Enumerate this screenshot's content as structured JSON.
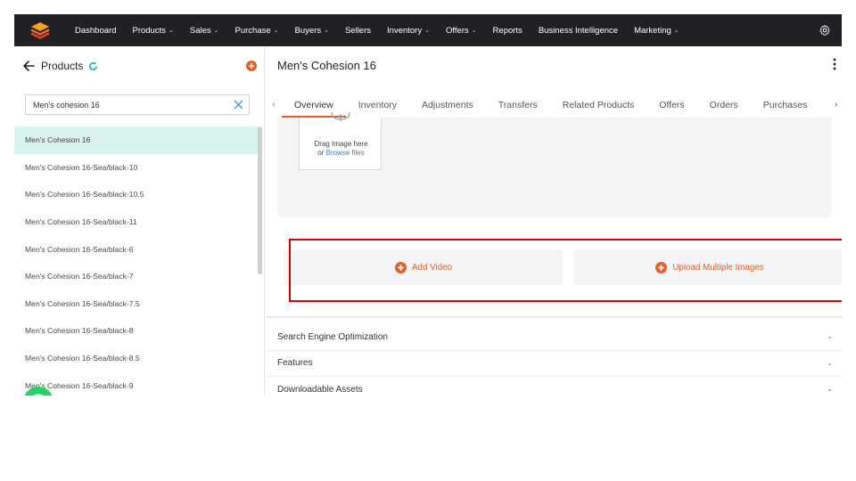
{
  "topnav": {
    "items": [
      {
        "label": "Dashboard",
        "has_dropdown": false
      },
      {
        "label": "Products",
        "has_dropdown": true
      },
      {
        "label": "Sales",
        "has_dropdown": true
      },
      {
        "label": "Purchase",
        "has_dropdown": true
      },
      {
        "label": "Buyers",
        "has_dropdown": true
      },
      {
        "label": "Sellers",
        "has_dropdown": false
      },
      {
        "label": "Inventory",
        "has_dropdown": true
      },
      {
        "label": "Offers",
        "has_dropdown": true
      },
      {
        "label": "Reports",
        "has_dropdown": false
      },
      {
        "label": "Business Intelligence",
        "has_dropdown": false
      },
      {
        "label": "Marketing",
        "has_dropdown": true
      }
    ],
    "chevron": "⌄"
  },
  "sidebar": {
    "title": "Products",
    "search_value": "Men's cohesion 16",
    "items": [
      {
        "label": "Men's Cohesion 16",
        "active": true
      },
      {
        "label": "Men's Cohesion 16-Sea/black-10",
        "active": false
      },
      {
        "label": "Men's Cohesion 16-Sea/black-10.5",
        "active": false
      },
      {
        "label": "Men's Cohesion 16-Sea/black-11",
        "active": false
      },
      {
        "label": "Men's Cohesion 16-Sea/black-6",
        "active": false
      },
      {
        "label": "Men's Cohesion 16-Sea/black-7",
        "active": false
      },
      {
        "label": "Men's Cohesion 16-Sea/black-7.5",
        "active": false
      },
      {
        "label": "Men's Cohesion 16-Sea/black-8",
        "active": false
      },
      {
        "label": "Men's Cohesion 16-Sea/black-8.5",
        "active": false
      },
      {
        "label": "Men's Cohesion 16-Sea/black-9",
        "active": false
      }
    ]
  },
  "main": {
    "title": "Men's Cohesion 16",
    "tabs": [
      {
        "label": "Overview",
        "active": true
      },
      {
        "label": "Inventory",
        "active": false
      },
      {
        "label": "Adjustments",
        "active": false
      },
      {
        "label": "Transfers",
        "active": false
      },
      {
        "label": "Related Products",
        "active": false
      },
      {
        "label": "Offers",
        "active": false
      },
      {
        "label": "Orders",
        "active": false
      },
      {
        "label": "Purchases",
        "active": false
      }
    ],
    "drop_zone": {
      "line1": "Drag Image here",
      "line2_prefix": "or ",
      "link": "Browse files"
    },
    "add_video_label": "Add Video",
    "upload_images_label": "Upload Multiple Images",
    "accordion": [
      {
        "label": "Search Engine Optimization"
      },
      {
        "label": "Features"
      },
      {
        "label": "Downloadable Assets"
      }
    ]
  },
  "colors": {
    "accent": "#e85d26",
    "nav_bg": "#202124",
    "active_row": "#d9f3f0",
    "link": "#3e7de3",
    "highlight_box": "#e00000",
    "whatsapp": "#25d366"
  },
  "icons": [
    "logo-icon",
    "gear-icon",
    "back-arrow-icon",
    "refresh-icon",
    "add-circle-icon",
    "clear-icon",
    "kebab-menu-icon",
    "upload-cloud-icon",
    "plus-circle-icon",
    "whatsapp-icon",
    "chevron-down-icon"
  ]
}
